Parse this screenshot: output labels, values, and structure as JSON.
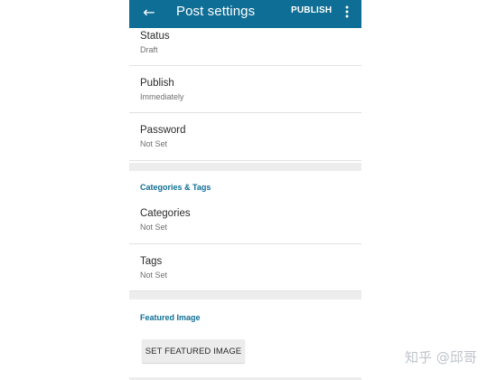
{
  "appbar": {
    "title": "Post settings",
    "publish_label": "PUBLISH",
    "back_icon": "arrow-left-icon",
    "overflow_icon": "more-vertical-icon",
    "background_color": "#0f6e95"
  },
  "settings": {
    "status": {
      "label": "Status",
      "value": "Draft"
    },
    "publish": {
      "label": "Publish",
      "value": "Immediately"
    },
    "password": {
      "label": "Password",
      "value": "Not Set"
    }
  },
  "categories_tags": {
    "header": "Categories & Tags",
    "categories": {
      "label": "Categories",
      "value": "Not Set"
    },
    "tags": {
      "label": "Tags",
      "value": "Not Set"
    }
  },
  "featured_image": {
    "header": "Featured Image",
    "button_label": "SET FEATURED IMAGE"
  },
  "watermark": "知乎 @邱哥",
  "colors": {
    "accent": "#0f6e95",
    "section_gap": "#ededed"
  }
}
